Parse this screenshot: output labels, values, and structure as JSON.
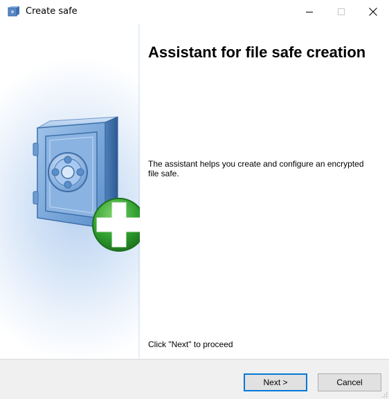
{
  "window": {
    "title": "Create safe",
    "icon": "safe-app-icon",
    "controls": {
      "minimize_icon": "minimize-icon",
      "maximize_icon": "maximize-icon",
      "close_icon": "close-icon"
    }
  },
  "banner": {
    "image": "safe-add-icon"
  },
  "content": {
    "heading": "Assistant for file safe creation",
    "description": "The assistant helps you create and configure an encrypted file safe.",
    "proceed_hint": "Click \"Next\" to proceed"
  },
  "footer": {
    "next_label": "Next >",
    "cancel_label": "Cancel"
  },
  "colors": {
    "accent": "#0078d7",
    "footer_bg": "#f0f0f0",
    "button_bg": "#e1e1e1",
    "banner_glow": "#b9d2ef",
    "plus_green": "#2e9e2e"
  }
}
